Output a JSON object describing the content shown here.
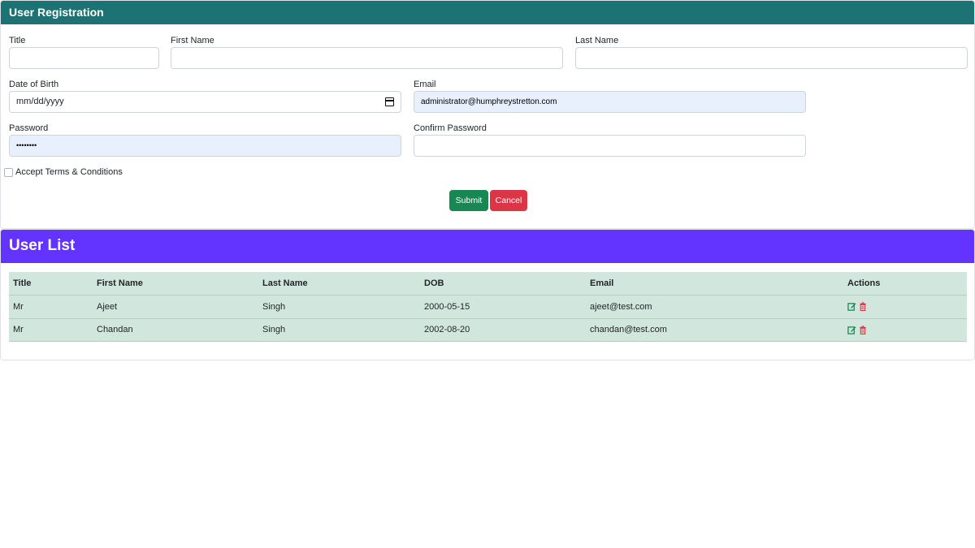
{
  "registration": {
    "header": "User Registration",
    "labels": {
      "title": "Title",
      "first_name": "First Name",
      "last_name": "Last Name",
      "dob": "Date of Birth",
      "email": "Email",
      "password": "Password",
      "confirm_password": "Confirm Password",
      "terms": "Accept Terms & Conditions"
    },
    "values": {
      "title": "",
      "first_name": "",
      "last_name": "",
      "dob": "mm/dd/yyyy",
      "email": "administrator@humphreystretton.com",
      "password": "••••••••",
      "confirm_password": ""
    },
    "terms_checked": false,
    "submit_label": "Submit",
    "cancel_label": "Cancel"
  },
  "user_list": {
    "header": "User List",
    "columns": [
      "Title",
      "First Name",
      "Last Name",
      "DOB",
      "Email",
      "Actions"
    ],
    "rows": [
      {
        "title": "Mr",
        "first_name": "Ajeet",
        "last_name": "Singh",
        "dob": "2000-05-15",
        "email": "ajeet@test.com"
      },
      {
        "title": "Mr",
        "first_name": "Chandan",
        "last_name": "Singh",
        "dob": "2002-08-20",
        "email": "chandan@test.com"
      }
    ],
    "action_icons": [
      "edit-icon",
      "trash-icon"
    ]
  },
  "colors": {
    "registration_header": "#1d7373",
    "list_header": "#6333ff",
    "submit": "#198754",
    "cancel": "#dc3545",
    "table_row": "#d1e7dd",
    "edit_icon": "#198754",
    "trash_icon": "#dc3545"
  }
}
